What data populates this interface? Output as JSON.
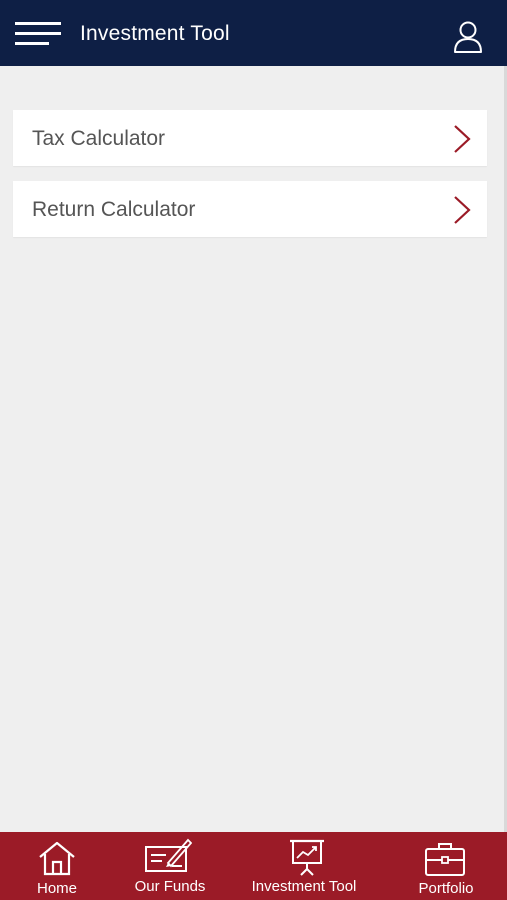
{
  "header": {
    "title": "Investment Tool",
    "menu_icon": "hamburger-menu-icon",
    "profile_icon": "user-profile-icon"
  },
  "menu_items": [
    {
      "label": "Tax Calculator",
      "icon": "chevron-right-icon"
    },
    {
      "label": "Return Calculator",
      "icon": "chevron-right-icon"
    }
  ],
  "bottom_nav": [
    {
      "label": "Home",
      "icon": "home-icon"
    },
    {
      "label": "Our Funds",
      "icon": "funds-cheque-icon"
    },
    {
      "label": "Investment Tool",
      "icon": "presentation-chart-icon"
    },
    {
      "label": "Portfolio",
      "icon": "briefcase-icon"
    }
  ],
  "colors": {
    "header_bg": "#0e1f45",
    "accent": "#9b1b27",
    "page_bg": "#efefef"
  }
}
